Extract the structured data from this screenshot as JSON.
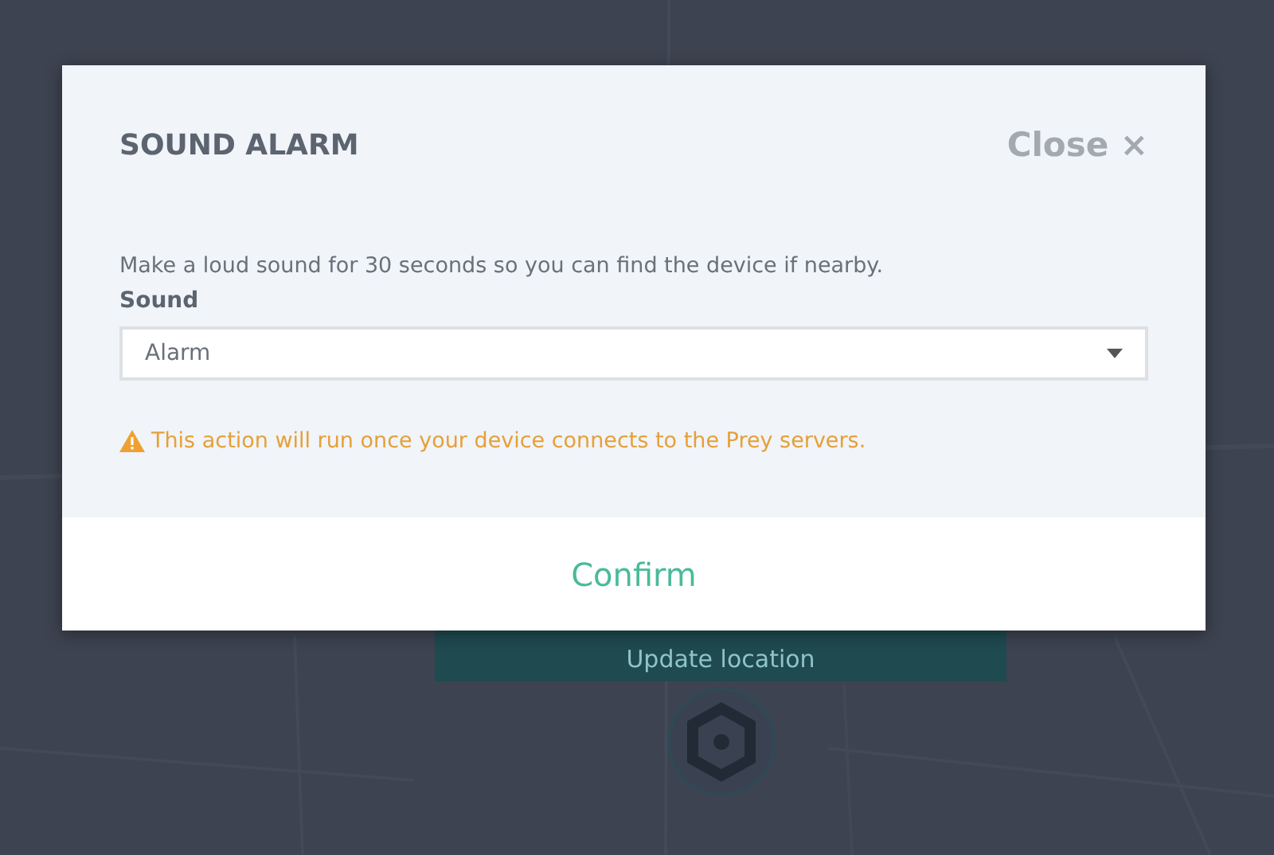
{
  "background": {
    "update_button": {
      "label": "Update location"
    }
  },
  "dialog": {
    "title": "SOUND ALARM",
    "close_label": "Close ×",
    "description": "Make a loud sound for 30 seconds so you can find the device if nearby.",
    "field_label": "Sound",
    "select": {
      "value": "Alarm"
    },
    "warning": "This action will run once your device connects to the Prey servers.",
    "confirm_label": "Confirm"
  }
}
